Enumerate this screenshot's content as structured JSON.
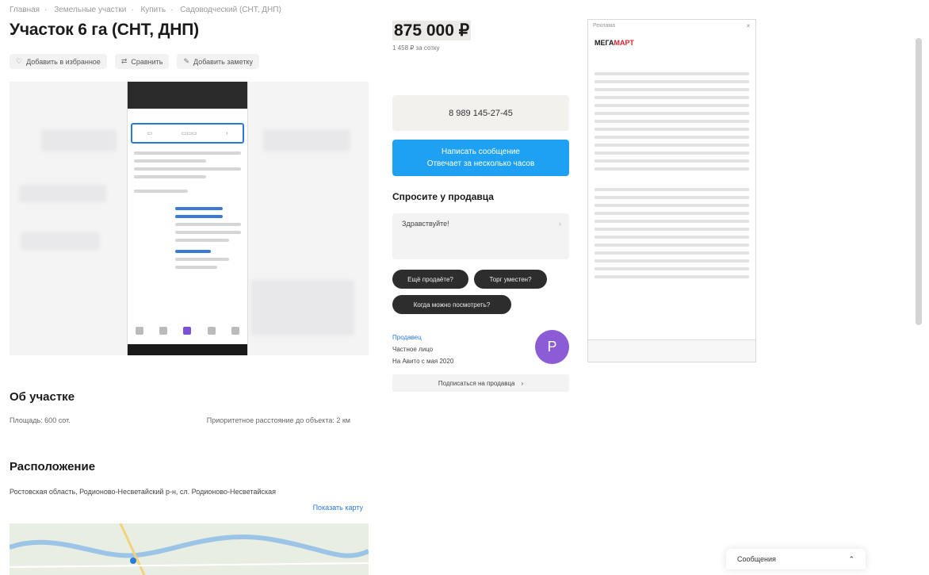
{
  "breadcrumb": [
    "Главная",
    "Земельные участки",
    "Купить",
    "Садоводческий (СНТ, ДНП)"
  ],
  "listing": {
    "title": "Участок 6 га (СНТ, ДНП)",
    "actions": [
      "Добавить в избранное",
      "Сравнить",
      "Добавить заметку"
    ],
    "price": "875 000 ₽",
    "price_per_unit": "1 458 ₽ за сотку"
  },
  "contact": {
    "phone": "8 989 145-27-45",
    "message_button": "Написать сообщение\nОтвечает за несколько часов"
  },
  "ask": {
    "heading": "Спросите у продавца",
    "placeholder": "Здравствуйте!",
    "chips": [
      "Ещё продаёте?",
      "Торг уместен?",
      "Когда можно посмотреть?"
    ]
  },
  "seller": {
    "name": "Продавец",
    "type": "Частное лицо",
    "since": "На Авито с мая 2020",
    "avatar_letter": "Р",
    "subscribe_button": "Подписаться на продавца"
  },
  "about": {
    "heading": "Об участке",
    "area_label": "Площадь: 600 сот.",
    "note": "Приоритетное расстояние до объекта: 2 км"
  },
  "location": {
    "heading": "Расположение",
    "address": "Ростовская область, Родионово-Несветайский р-н, сл. Родионово-Несветайская",
    "map_link": "Показать карту"
  },
  "ad": {
    "label": "Реклама",
    "logo_part1": "МЕГА",
    "logo_part2": "МАРТ"
  },
  "chat": {
    "label": "Сообщения"
  }
}
